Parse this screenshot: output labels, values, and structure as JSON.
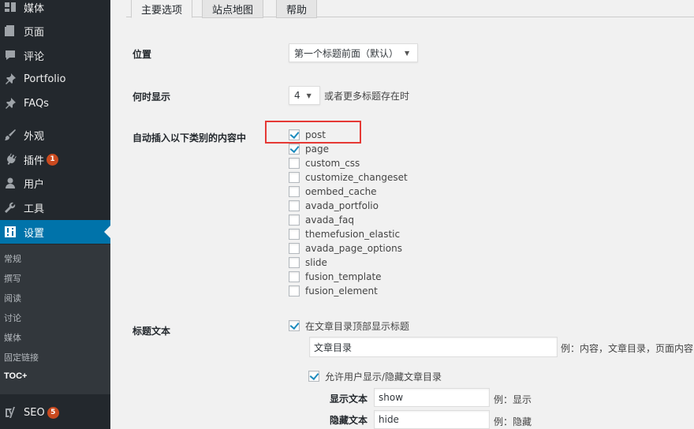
{
  "sidebar": {
    "items": [
      {
        "label": "媒体",
        "icon": "media-icon",
        "top": 0
      },
      {
        "label": "页面",
        "icon": "page-icon"
      },
      {
        "label": "评论",
        "icon": "comment-icon"
      },
      {
        "label": "Portfolio",
        "icon": "pin-icon"
      },
      {
        "label": "FAQs",
        "icon": "pin-icon"
      },
      {
        "label": "外观",
        "icon": "brush-icon"
      },
      {
        "label": "插件",
        "icon": "plugin-icon",
        "badge": "1"
      },
      {
        "label": "用户",
        "icon": "user-icon"
      },
      {
        "label": "工具",
        "icon": "wrench-icon"
      },
      {
        "label": "设置",
        "icon": "settings-icon"
      }
    ],
    "submenu": [
      "常规",
      "撰写",
      "阅读",
      "讨论",
      "媒体",
      "固定链接",
      "TOC+"
    ],
    "seo": {
      "label": "SEO",
      "badge": "5"
    }
  },
  "tabs": [
    "主要选项",
    "站点地图",
    "帮助"
  ],
  "settings": {
    "position_label": "位置",
    "position_value": "第一个标题前面（默认）",
    "show_when_label": "何时显示",
    "show_when_value": "4",
    "show_when_suffix": "或者更多标题存在时",
    "auto_insert_label": "自动插入以下类别的内容中",
    "post_types": [
      {
        "name": "post",
        "checked": true
      },
      {
        "name": "page",
        "checked": true
      },
      {
        "name": "custom_css",
        "checked": false
      },
      {
        "name": "customize_changeset",
        "checked": false
      },
      {
        "name": "oembed_cache",
        "checked": false
      },
      {
        "name": "avada_portfolio",
        "checked": false
      },
      {
        "name": "avada_faq",
        "checked": false
      },
      {
        "name": "themefusion_elastic",
        "checked": false
      },
      {
        "name": "avada_page_options",
        "checked": false
      },
      {
        "name": "slide",
        "checked": false
      },
      {
        "name": "fusion_template",
        "checked": false
      },
      {
        "name": "fusion_element",
        "checked": false
      }
    ],
    "heading_text_label": "标题文本",
    "show_title_checkbox": "在文章目录顶部显示标题",
    "title_value": "文章目录",
    "title_example": "例：内容，文章目录，页面内容",
    "toggle_checkbox": "允许用户显示/隐藏文章目录",
    "show_text_label": "显示文本",
    "show_text_value": "show",
    "show_text_example": "例：显示",
    "hide_text_label": "隐藏文本",
    "hide_text_value": "hide",
    "hide_text_example": "例：隐藏"
  }
}
